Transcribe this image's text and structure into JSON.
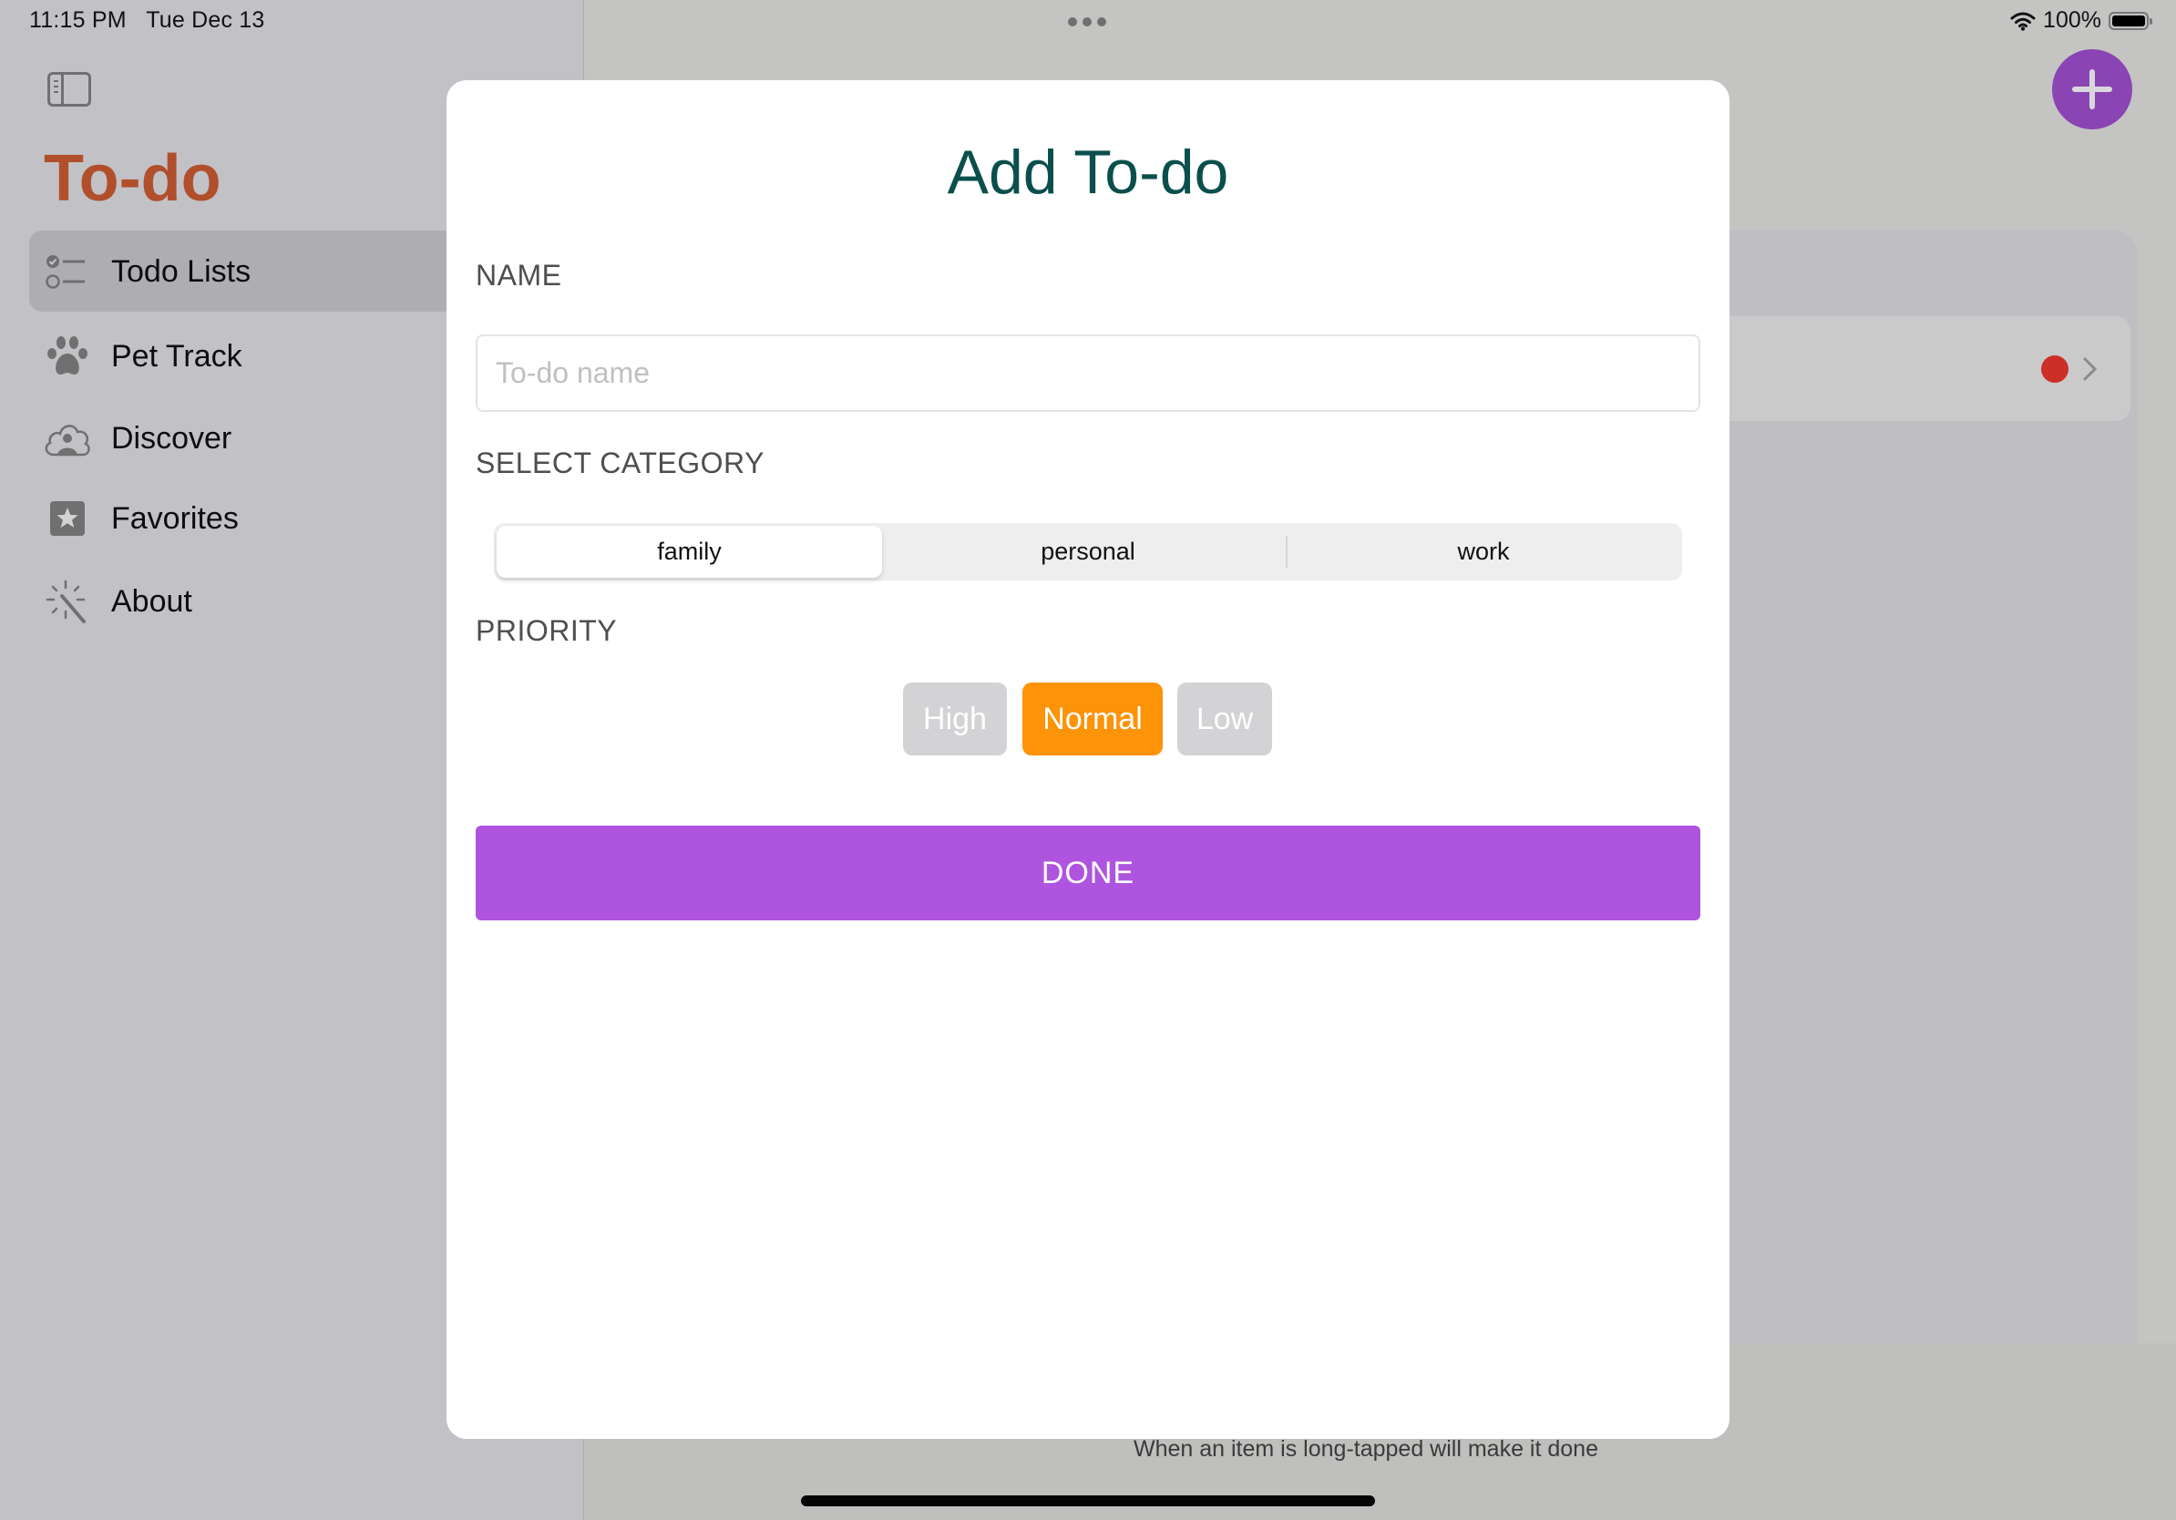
{
  "status_bar": {
    "time": "11:15 PM",
    "date": "Tue Dec 13",
    "battery": "100%"
  },
  "sidebar": {
    "title": "To-do",
    "items": [
      {
        "label": "Todo Lists",
        "icon": "checklist-icon",
        "selected": true
      },
      {
        "label": "Pet Track",
        "icon": "paw-icon",
        "selected": false
      },
      {
        "label": "Discover",
        "icon": "cloud-person-icon",
        "selected": false
      },
      {
        "label": "Favorites",
        "icon": "star-square-icon",
        "selected": false
      },
      {
        "label": "About",
        "icon": "magic-wand-icon",
        "selected": false
      }
    ]
  },
  "main": {
    "list_row": {
      "status_color": "#cc2f27"
    },
    "footer_hint": "When an item is long-tapped will make it done"
  },
  "modal": {
    "title": "Add To-do",
    "name_label": "NAME",
    "name_value": "",
    "name_placeholder": "To-do name",
    "category_label": "SELECT CATEGORY",
    "categories": [
      "family",
      "personal",
      "work"
    ],
    "selected_category": "family",
    "priority_label": "PRIORITY",
    "priorities": [
      "High",
      "Normal",
      "Low"
    ],
    "selected_priority": "Normal",
    "done_label": "DONE"
  },
  "colors": {
    "app_title": "#b14f2c",
    "modal_title": "#0b4f4c",
    "accent_purple": "#af54df",
    "add_button": "#8b44b4",
    "priority_active": "#fd9307",
    "priority_inactive": "#d3d3d6"
  }
}
